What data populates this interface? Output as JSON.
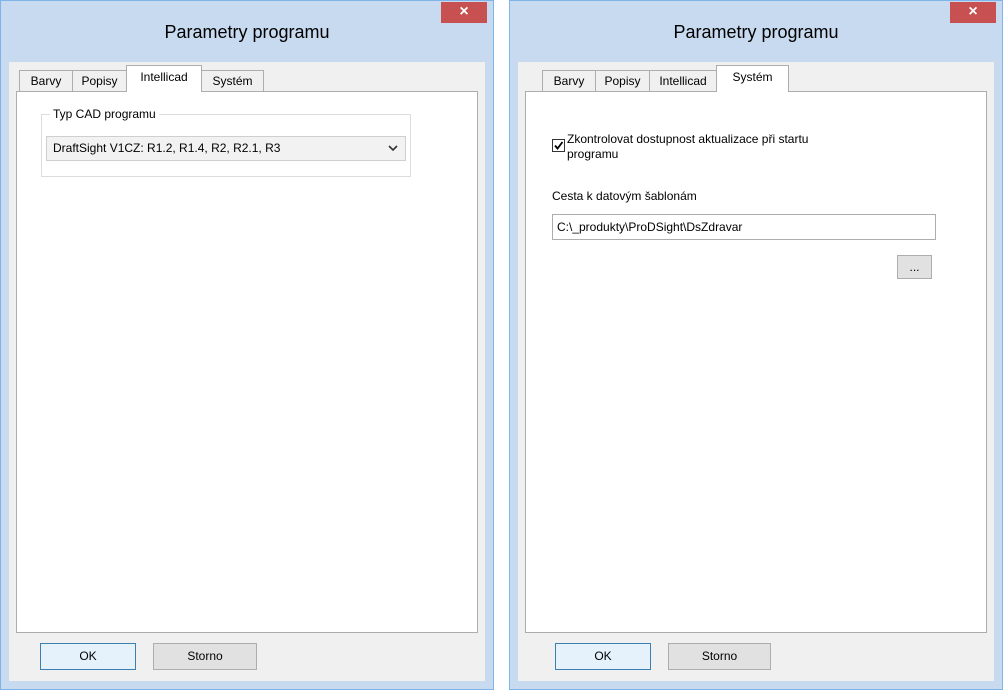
{
  "left_dialog": {
    "title": "Parametry programu",
    "close_symbol": "×",
    "tabs": [
      {
        "label": "Barvy",
        "active": false
      },
      {
        "label": "Popisy",
        "active": false
      },
      {
        "label": "Intellicad",
        "active": true
      },
      {
        "label": "Systém",
        "active": false
      }
    ],
    "group_label": "Typ CAD programu",
    "cad_select_value": "DraftSight V1CZ: R1.2, R1.4, R2, R2.1, R3",
    "ok_label": "OK",
    "cancel_label": "Storno"
  },
  "right_dialog": {
    "title": "Parametry programu",
    "close_symbol": "×",
    "tabs": [
      {
        "label": "Barvy",
        "active": false
      },
      {
        "label": "Popisy",
        "active": false
      },
      {
        "label": "Intellicad",
        "active": false
      },
      {
        "label": "Systém",
        "active": true
      }
    ],
    "check_updates_label_line1": "Zkontrolovat dostupnost aktualizace při startu",
    "check_updates_label_line2": "programu",
    "check_updates_checked": true,
    "template_path_label": "Cesta k datovým šablonám",
    "template_path_value": "C:\\_produkty\\ProDSight\\DsZdravar",
    "browse_label": "...",
    "ok_label": "OK",
    "cancel_label": "Storno"
  },
  "colors": {
    "title_bar": "#c8daf0",
    "close_button": "#c75050",
    "window_border": "#7eb4ea",
    "dialog_background": "#f0f0f0"
  },
  "icons": {
    "close": "close-icon",
    "dropdown": "chevron-down-icon",
    "check": "checkmark-icon"
  }
}
